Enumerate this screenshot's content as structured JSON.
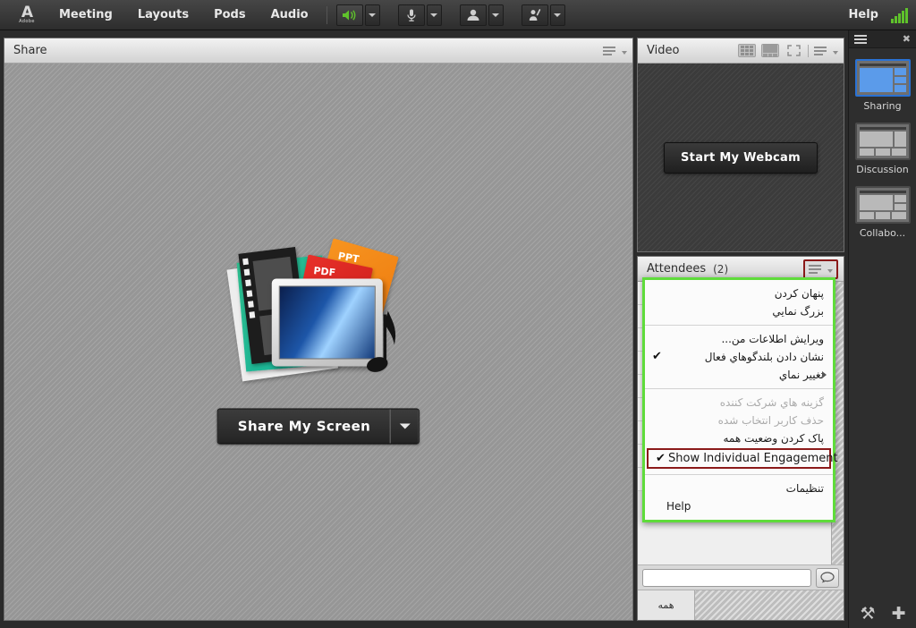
{
  "menubar": {
    "logo_mark": "A",
    "logo_word": "Adobe",
    "items": [
      {
        "label": "Meeting",
        "name": "menu-meeting"
      },
      {
        "label": "Layouts",
        "name": "menu-layouts"
      },
      {
        "label": "Pods",
        "name": "menu-pods"
      },
      {
        "label": "Audio",
        "name": "menu-audio"
      }
    ],
    "help_label": "Help",
    "controls": [
      {
        "name": "speaker-button",
        "state": "on"
      },
      {
        "name": "microphone-button",
        "state": "off"
      },
      {
        "name": "webcam-button",
        "state": "off"
      },
      {
        "name": "raise-hand-button",
        "state": "off"
      }
    ],
    "signal_bars": 5,
    "signal_color": "#5fc22b"
  },
  "share_pod": {
    "title": "Share",
    "share_button_label": "Share My Screen",
    "art_labels": {
      "ppt": "PPT",
      "pdf": "PDF"
    }
  },
  "video_pod": {
    "title": "Video",
    "webcam_button_label": "Start My Webcam"
  },
  "attendees_pod": {
    "title": "Attendees",
    "count": "(2)",
    "chat_input_value": "",
    "chat_input_placeholder": "",
    "chat_tab_all": "همه"
  },
  "context_menu": {
    "border_color": "#5fdc3b",
    "highlight_color": "#8b1a1a",
    "groups": [
      {
        "items": [
          {
            "label": "پنهان کردن",
            "name": "menu-hide",
            "checked": false,
            "disabled": false,
            "submenu": false,
            "rtl": true
          },
          {
            "label": "بزرگ نمايي",
            "name": "menu-maximize",
            "checked": false,
            "disabled": false,
            "submenu": false,
            "rtl": true
          }
        ]
      },
      {
        "items": [
          {
            "label": "ويرايش اطلاعات من...",
            "name": "menu-edit-my-info",
            "checked": false,
            "disabled": false,
            "submenu": false,
            "rtl": true
          },
          {
            "label": "نشان دادن بلندگوهاي فعال",
            "name": "menu-show-active-speakers",
            "checked": true,
            "disabled": false,
            "submenu": false,
            "rtl": true
          },
          {
            "label": "تغییر نماي",
            "name": "menu-change-view",
            "checked": false,
            "disabled": false,
            "submenu": true,
            "rtl": true
          }
        ]
      },
      {
        "items": [
          {
            "label": "گزينه هاي شركت كننده",
            "name": "menu-attendee-options",
            "checked": false,
            "disabled": true,
            "submenu": false,
            "rtl": true
          },
          {
            "label": "حذف كاربر انتخاب شده",
            "name": "menu-remove-selected-user",
            "checked": false,
            "disabled": true,
            "submenu": false,
            "rtl": true
          },
          {
            "label": "پاک کردن وضعيت همه",
            "name": "menu-clear-everyones-status",
            "checked": false,
            "disabled": false,
            "submenu": false,
            "rtl": true
          }
        ]
      },
      {
        "items": [
          {
            "label": "تنظيمات",
            "name": "menu-preferences",
            "checked": false,
            "disabled": false,
            "submenu": false,
            "rtl": true
          },
          {
            "label": "Help",
            "name": "menu-help",
            "checked": false,
            "disabled": false,
            "submenu": false,
            "rtl": false
          }
        ]
      }
    ],
    "highlighted_item": {
      "label": "Show Individual Engagement",
      "name": "menu-show-individual-engagement",
      "checked": true
    }
  },
  "sidebar": {
    "close_label": "✖",
    "layouts": [
      {
        "label": "Sharing",
        "name": "layout-sharing",
        "selected": true
      },
      {
        "label": "Discussion",
        "name": "layout-discussion",
        "selected": false
      },
      {
        "label": "Collabo...",
        "name": "layout-collaboration",
        "selected": false
      }
    ],
    "bottom_icons": [
      {
        "glyph": "⚒",
        "name": "tools-icon"
      },
      {
        "glyph": "✚",
        "name": "add-layout-icon"
      }
    ]
  }
}
